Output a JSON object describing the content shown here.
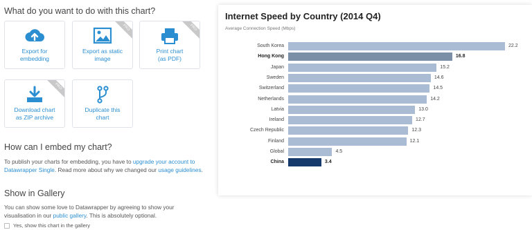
{
  "left": {
    "question": "What do you want to do with this chart?",
    "tiles": [
      {
        "label": "Export for\nembedding",
        "icon": "cloud-upload-icon",
        "ribbon": ""
      },
      {
        "label": "Export as static\nimage",
        "icon": "image-icon",
        "ribbon": "PRO"
      },
      {
        "label": "Print chart\n(as PDF)",
        "icon": "printer-icon",
        "ribbon": "PRO"
      },
      {
        "label": "Download chart\nas ZIP archive",
        "icon": "download-icon",
        "ribbon": "PRO"
      },
      {
        "label": "Duplicate this\nchart",
        "icon": "fork-icon",
        "ribbon": ""
      }
    ],
    "embed_heading": "How can I embed my chart?",
    "embed_text_1": "To publish your charts for embedding, you have to",
    "embed_link_1": "upgrade your account to Datawrapper Single",
    "embed_text_2": ". Read more about why we changed our",
    "embed_link_2": "usage guidelines",
    "embed_text_3": ".",
    "gallery_heading": "Show in Gallery",
    "gallery_text_1": "You can show some love to Datawrapper by agreeing to show your visualisation in our",
    "gallery_link": "public gallery",
    "gallery_text_2": ". This is absolutely optional.",
    "gallery_checkbox": "Yes, show this chart in the gallery"
  },
  "accent_color": "#2b8ed0",
  "chart_data": {
    "type": "bar",
    "orientation": "horizontal",
    "title": "Internet Speed by Country (2014 Q4)",
    "subtitle": "Average Connection Speed (Mbps)",
    "categories": [
      "South Korea",
      "Hong Kong",
      "Japan",
      "Sweden",
      "Switzerland",
      "Netherlands",
      "Latvia",
      "Ireland",
      "Czech Republic",
      "Finland",
      "Global",
      "China"
    ],
    "values": [
      22.2,
      16.8,
      15.2,
      14.6,
      14.5,
      14.2,
      13.0,
      12.7,
      12.3,
      12.1,
      4.5,
      3.4
    ],
    "value_labels": [
      "22.2",
      "16.8",
      "15.2",
      "14.6",
      "14.5",
      "14.2",
      "13.0",
      "12.7",
      "12.3",
      "12.1",
      "4.5",
      "3.4"
    ],
    "highlighted": [
      "Hong Kong",
      "China"
    ],
    "colors": {
      "default": "#a9bcd3",
      "Hong Kong": "#7b8fa7",
      "China": "#14396a"
    },
    "xlim": [
      0,
      22.2
    ]
  }
}
